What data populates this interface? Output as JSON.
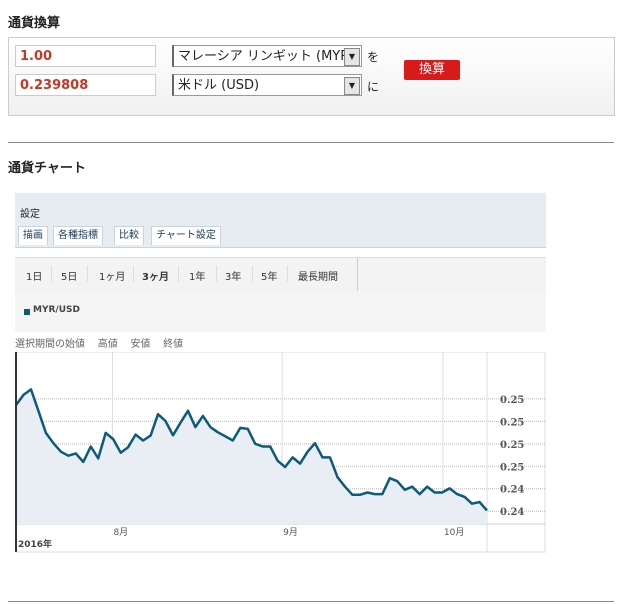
{
  "converter": {
    "title": "通貨換算",
    "amount": "1.00",
    "result": "0.239808",
    "from_currency": "マレーシア リンギット (MYR)",
    "to_currency": "米ドル (USD)",
    "from_suffix": "を",
    "to_suffix": "に",
    "convert_label": "換算"
  },
  "chart_section": {
    "title": "通貨チャート",
    "settings_label": "設定",
    "tabs": [
      "描画",
      "各種指標",
      "比較",
      "チャート設定"
    ],
    "periods": [
      "1日",
      "5日",
      "1ヶ月",
      "3ヶ月",
      "1年",
      "3年",
      "5年",
      "最長期間"
    ],
    "selected_period": "3ヶ月",
    "legend": "MYR/USD",
    "stats": [
      "選択期間の始値",
      "高値",
      "安値",
      "終値"
    ]
  },
  "colors": {
    "accent": "#d91a1a",
    "line": "#0d5a7a",
    "fill": "#e8eef4"
  },
  "chart_data": {
    "type": "area",
    "series": [
      {
        "name": "MYR/USD",
        "values": [
          0.24945,
          0.25036,
          0.25085,
          0.24894,
          0.24697,
          0.24606,
          0.2453,
          0.24494,
          0.24515,
          0.24439,
          0.24576,
          0.2447,
          0.24697,
          0.24642,
          0.24521,
          0.2457,
          0.24682,
          0.2463,
          0.24673,
          0.24864,
          0.24803,
          0.24676,
          0.24788,
          0.24894,
          0.24749,
          0.24849,
          0.24749,
          0.24703,
          0.24667,
          0.2463,
          0.24742,
          0.24733,
          0.246,
          0.24576,
          0.24576,
          0.24449,
          0.24394,
          0.24479,
          0.24424,
          0.2453,
          0.24606,
          0.24479,
          0.24479,
          0.24303,
          0.24218,
          0.24146,
          0.24146,
          0.24167,
          0.24152,
          0.24152,
          0.24294,
          0.24267,
          0.24191,
          0.24218,
          0.24152,
          0.24218,
          0.24167,
          0.24167,
          0.24203,
          0.24152,
          0.24127,
          0.24067,
          0.24082,
          0.24006
        ]
      }
    ],
    "yticks": [
      0.25,
      0.248,
      0.246,
      0.244,
      0.242,
      0.24
    ],
    "ytick_labels": [
      "0.25",
      "0.25",
      "0.25",
      "0.25",
      "0.24",
      "0.24"
    ],
    "ylim": [
      0.23886,
      0.25418
    ],
    "xticks": [
      {
        "index": 12.9,
        "label": "8月"
      },
      {
        "index": 35.6,
        "label": "9月"
      },
      {
        "index": 57.1,
        "label": "10月"
      }
    ],
    "year_label": "2016年"
  }
}
